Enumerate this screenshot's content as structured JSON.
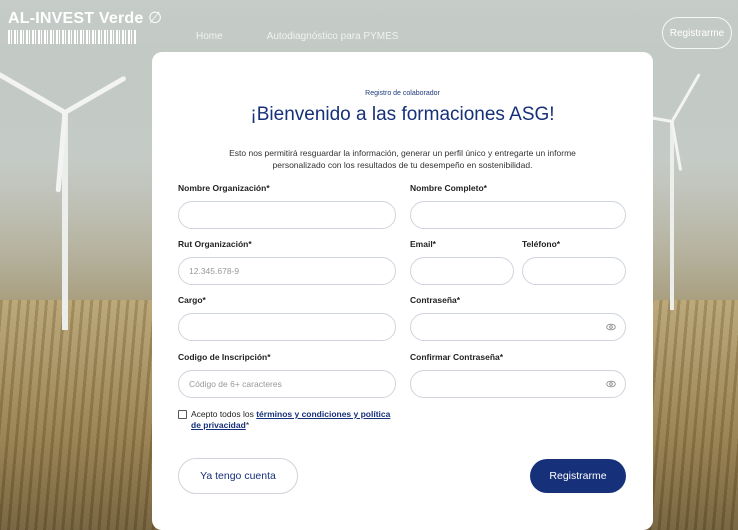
{
  "header": {
    "brand": "AL-INVEST Verde",
    "nav": [
      "Home",
      "Autodiagnóstico para PYMES"
    ],
    "register_label": "Registrarme"
  },
  "form": {
    "subtitle": "Registro de colaborador",
    "title": "¡Bienvenido a las formaciones ASG!",
    "description_line1": "Esto nos permitirá resguardar la información, generar un perfil único y entregarte un informe",
    "description_line2": "personalizado con los resultados de tu desempeño en sostenibilidad.",
    "fields": {
      "org_name": {
        "label": "Nombre Organización*",
        "value": "",
        "placeholder": ""
      },
      "full_name": {
        "label": "Nombre Completo*",
        "value": "",
        "placeholder": ""
      },
      "org_rut": {
        "label": "Rut Organización*",
        "value": "",
        "placeholder": "12.345.678-9"
      },
      "email": {
        "label": "Email*",
        "value": "",
        "placeholder": ""
      },
      "phone": {
        "label": "Teléfono*",
        "value": "",
        "placeholder": ""
      },
      "role": {
        "label": "Cargo*",
        "value": "",
        "placeholder": ""
      },
      "password": {
        "label": "Contraseña*",
        "value": "",
        "placeholder": ""
      },
      "code": {
        "label": "Codigo de Inscripción*",
        "value": "",
        "placeholder": "Código de 6+ caracteres"
      },
      "confirm_password": {
        "label": "Confirmar Contraseña*",
        "value": "",
        "placeholder": ""
      }
    },
    "terms": {
      "prefix": "Acepto todos los ",
      "link": "términos y condiciones y política de privacidad",
      "suffix": "*"
    },
    "buttons": {
      "login": "Ya tengo cuenta",
      "register": "Registrarme"
    }
  },
  "colors": {
    "primary": "#16307a",
    "border": "#cfd4dc"
  }
}
